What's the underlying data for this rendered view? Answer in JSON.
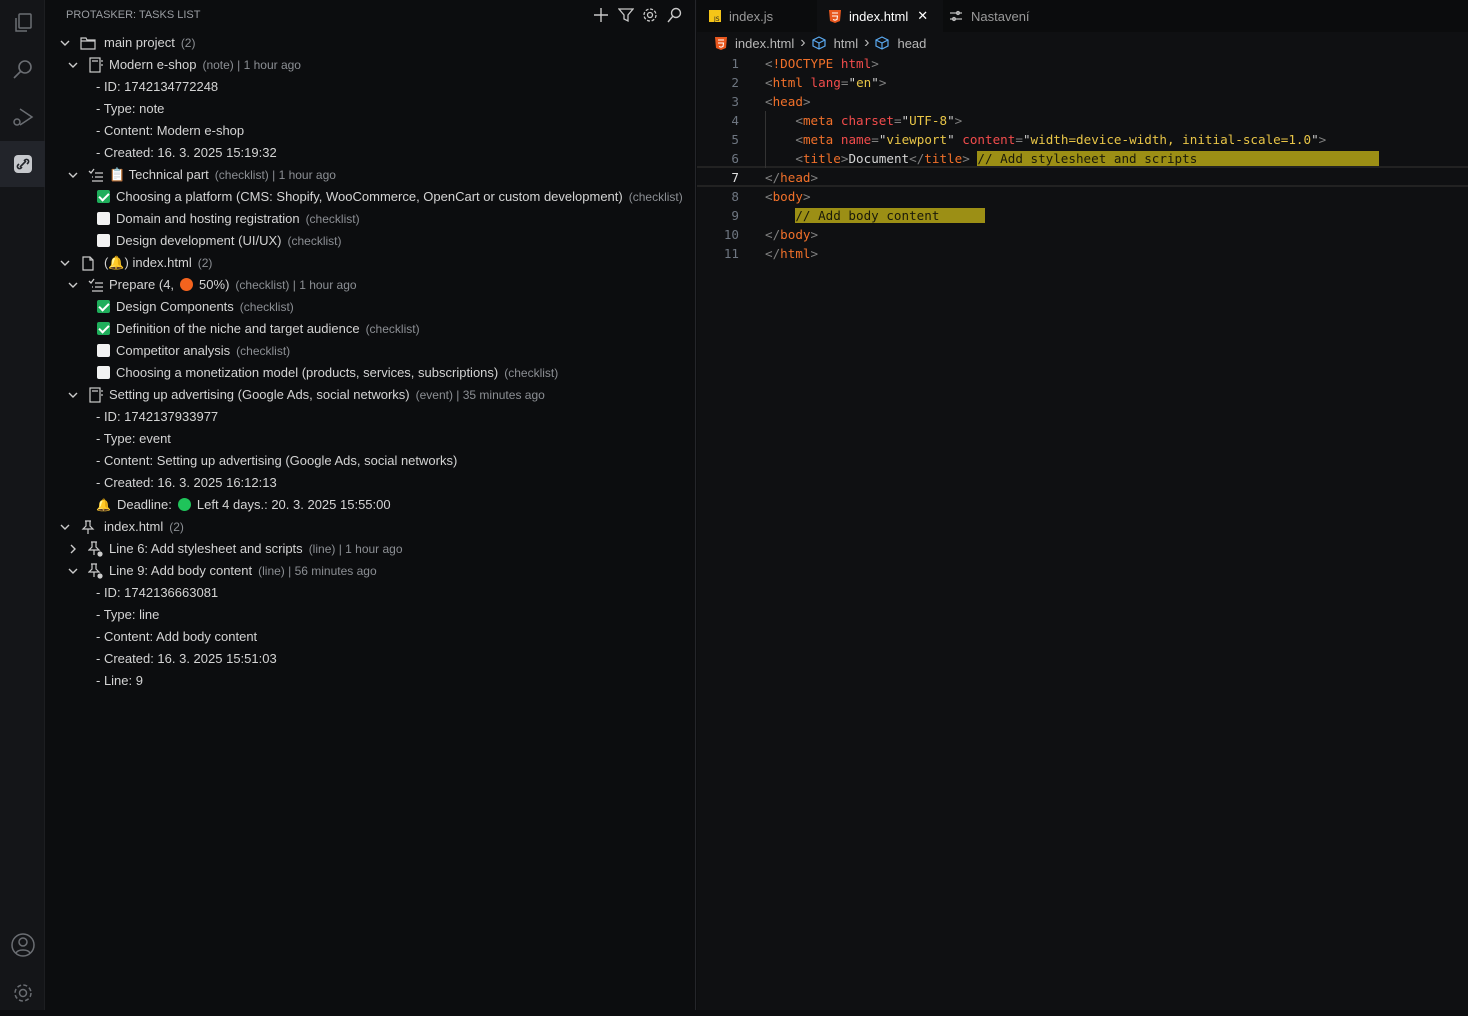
{
  "activity_bar": {
    "items": [
      "explorer-icon",
      "search-icon",
      "run-debug-icon",
      "protasker-icon"
    ],
    "bottom": [
      "account-icon",
      "settings-gear-icon"
    ]
  },
  "panel": {
    "title": "PROTASKER: TASKS LIST",
    "tools": [
      "add-icon",
      "filter-icon",
      "settings-icon",
      "search-icon"
    ]
  },
  "tree": [
    {
      "lvl": 0,
      "chev": "down",
      "icon": "folder",
      "label": "main project",
      "desc": "(2)"
    },
    {
      "lvl": 1,
      "chev": "down",
      "icon": "note",
      "label": "Modern e-shop",
      "desc": "(note) | 1 hour ago"
    },
    {
      "lvl": 2,
      "label": "- ID: 1742134772248"
    },
    {
      "lvl": 2,
      "label": "- Type: note"
    },
    {
      "lvl": 2,
      "label": "- Content: Modern e-shop"
    },
    {
      "lvl": 2,
      "label": "- Created: 16. 3. 2025 15:19:32"
    },
    {
      "lvl": 1,
      "chev": "down",
      "icon": "checklist",
      "label": "📋 Technical part",
      "desc": "(checklist) | 1 hour ago"
    },
    {
      "lvl": 3,
      "check": true,
      "label": "Choosing a platform (CMS: Shopify, WooCommerce, OpenCart or custom development)",
      "desc": "(checklist)"
    },
    {
      "lvl": 3,
      "check": false,
      "label": "Domain and hosting registration",
      "desc": "(checklist)"
    },
    {
      "lvl": 3,
      "check": false,
      "label": "Design development (UI/UX)",
      "desc": "(checklist)"
    },
    {
      "lvl": 0,
      "chev": "down",
      "icon": "file",
      "label": "(🔔) index.html",
      "desc": "(2)"
    },
    {
      "lvl": 1,
      "chev": "down",
      "icon": "checklist",
      "label": "Prepare (4,",
      "dot": "#f4631e",
      "label2": "50%)",
      "desc": "(checklist) | 1 hour ago"
    },
    {
      "lvl": 3,
      "check": true,
      "label": "Design Components",
      "desc": "(checklist)"
    },
    {
      "lvl": 3,
      "check": true,
      "label": "Definition of the niche and target audience",
      "desc": "(checklist)"
    },
    {
      "lvl": 3,
      "check": false,
      "label": "Competitor analysis",
      "desc": "(checklist)"
    },
    {
      "lvl": 3,
      "check": false,
      "label": "Choosing a monetization model (products, services, subscriptions)",
      "desc": "(checklist)"
    },
    {
      "lvl": 1,
      "chev": "down",
      "icon": "note",
      "label": "Setting up advertising (Google Ads, social networks)",
      "desc": "(event) | 35 minutes ago"
    },
    {
      "lvl": 2,
      "label": "- ID: 1742137933977"
    },
    {
      "lvl": 2,
      "label": "- Type: event"
    },
    {
      "lvl": 2,
      "label": "- Content: Setting up advertising (Google Ads, social networks)"
    },
    {
      "lvl": 2,
      "label": "- Created: 16. 3. 2025 16:12:13"
    },
    {
      "lvl": 2,
      "bell": true,
      "label": "Deadline:",
      "dot": "#1fc45a",
      "label2": "Left 4 days.: 20. 3. 2025 15:55:00"
    },
    {
      "lvl": 0,
      "chev": "down",
      "icon": "pin",
      "label": "index.html",
      "desc": "(2)"
    },
    {
      "lvl": 1,
      "chev": "right",
      "icon": "pin-dot",
      "label": "Line 6: Add stylesheet and scripts",
      "desc": "(line) | 1 hour ago"
    },
    {
      "lvl": 1,
      "chev": "down",
      "icon": "pin-dot",
      "label": "Line 9: Add body content",
      "desc": "(line) | 56 minutes ago"
    },
    {
      "lvl": 2,
      "label": "- ID: 1742136663081"
    },
    {
      "lvl": 2,
      "label": "- Type: line"
    },
    {
      "lvl": 2,
      "label": "- Content: Add body content"
    },
    {
      "lvl": 2,
      "label": "- Created: 16. 3. 2025 15:51:03"
    },
    {
      "lvl": 2,
      "label": "- Line: 9"
    }
  ],
  "tabs": [
    {
      "label": "index.js",
      "icon": "js-icon"
    },
    {
      "label": "index.html",
      "icon": "html5-icon",
      "active": true
    },
    {
      "label": "Nastavení",
      "icon": "settings-sliders-icon"
    }
  ],
  "breadcrumb": [
    "index.html",
    "html",
    "head"
  ],
  "code": {
    "current_line": 7,
    "lines": [
      [
        [
          "p",
          "<"
        ],
        [
          "t",
          "!DOCTYPE"
        ],
        [
          "x",
          " "
        ],
        [
          "a",
          "html"
        ],
        [
          "p",
          ">"
        ]
      ],
      [
        [
          "p",
          "<"
        ],
        [
          "t",
          "html"
        ],
        [
          "x",
          " "
        ],
        [
          "a",
          "lang"
        ],
        [
          "p",
          "="
        ],
        [
          "q",
          "\""
        ],
        [
          "s",
          "en"
        ],
        [
          "q",
          "\""
        ],
        [
          "p",
          ">"
        ]
      ],
      [
        [
          "p",
          "<"
        ],
        [
          "t",
          "head"
        ],
        [
          "p",
          ">"
        ]
      ],
      [
        [
          "x",
          "    "
        ],
        [
          "p",
          "<"
        ],
        [
          "t",
          "meta"
        ],
        [
          "x",
          " "
        ],
        [
          "a",
          "charset"
        ],
        [
          "p",
          "="
        ],
        [
          "q",
          "\""
        ],
        [
          "s",
          "UTF-8"
        ],
        [
          "q",
          "\""
        ],
        [
          "p",
          ">"
        ]
      ],
      [
        [
          "x",
          "    "
        ],
        [
          "p",
          "<"
        ],
        [
          "t",
          "meta"
        ],
        [
          "x",
          " "
        ],
        [
          "a",
          "name"
        ],
        [
          "p",
          "="
        ],
        [
          "q",
          "\""
        ],
        [
          "s",
          "viewport"
        ],
        [
          "q",
          "\""
        ],
        [
          "x",
          " "
        ],
        [
          "a",
          "content"
        ],
        [
          "p",
          "="
        ],
        [
          "q",
          "\""
        ],
        [
          "s",
          "width=device-width, initial-scale=1.0"
        ],
        [
          "q",
          "\""
        ],
        [
          "p",
          ">"
        ]
      ],
      [
        [
          "x",
          "    "
        ],
        [
          "p",
          "<"
        ],
        [
          "t",
          "title"
        ],
        [
          "p",
          ">"
        ],
        [
          "x",
          "Document"
        ],
        [
          "p",
          "</"
        ],
        [
          "t",
          "title"
        ],
        [
          "p",
          ">"
        ],
        [
          "x",
          " "
        ],
        [
          "hl",
          "// Add stylesheet and scripts                        "
        ]
      ],
      [
        [
          "p",
          "</"
        ],
        [
          "t",
          "head"
        ],
        [
          "p",
          ">"
        ]
      ],
      [
        [
          "p",
          "<"
        ],
        [
          "t",
          "body"
        ],
        [
          "p",
          ">"
        ]
      ],
      [
        [
          "x",
          "    "
        ],
        [
          "hl",
          "// Add body content      "
        ]
      ],
      [
        [
          "p",
          "</"
        ],
        [
          "t",
          "body"
        ],
        [
          "p",
          ">"
        ]
      ],
      [
        [
          "p",
          "</"
        ],
        [
          "t",
          "html"
        ],
        [
          "p",
          ">"
        ]
      ]
    ]
  }
}
